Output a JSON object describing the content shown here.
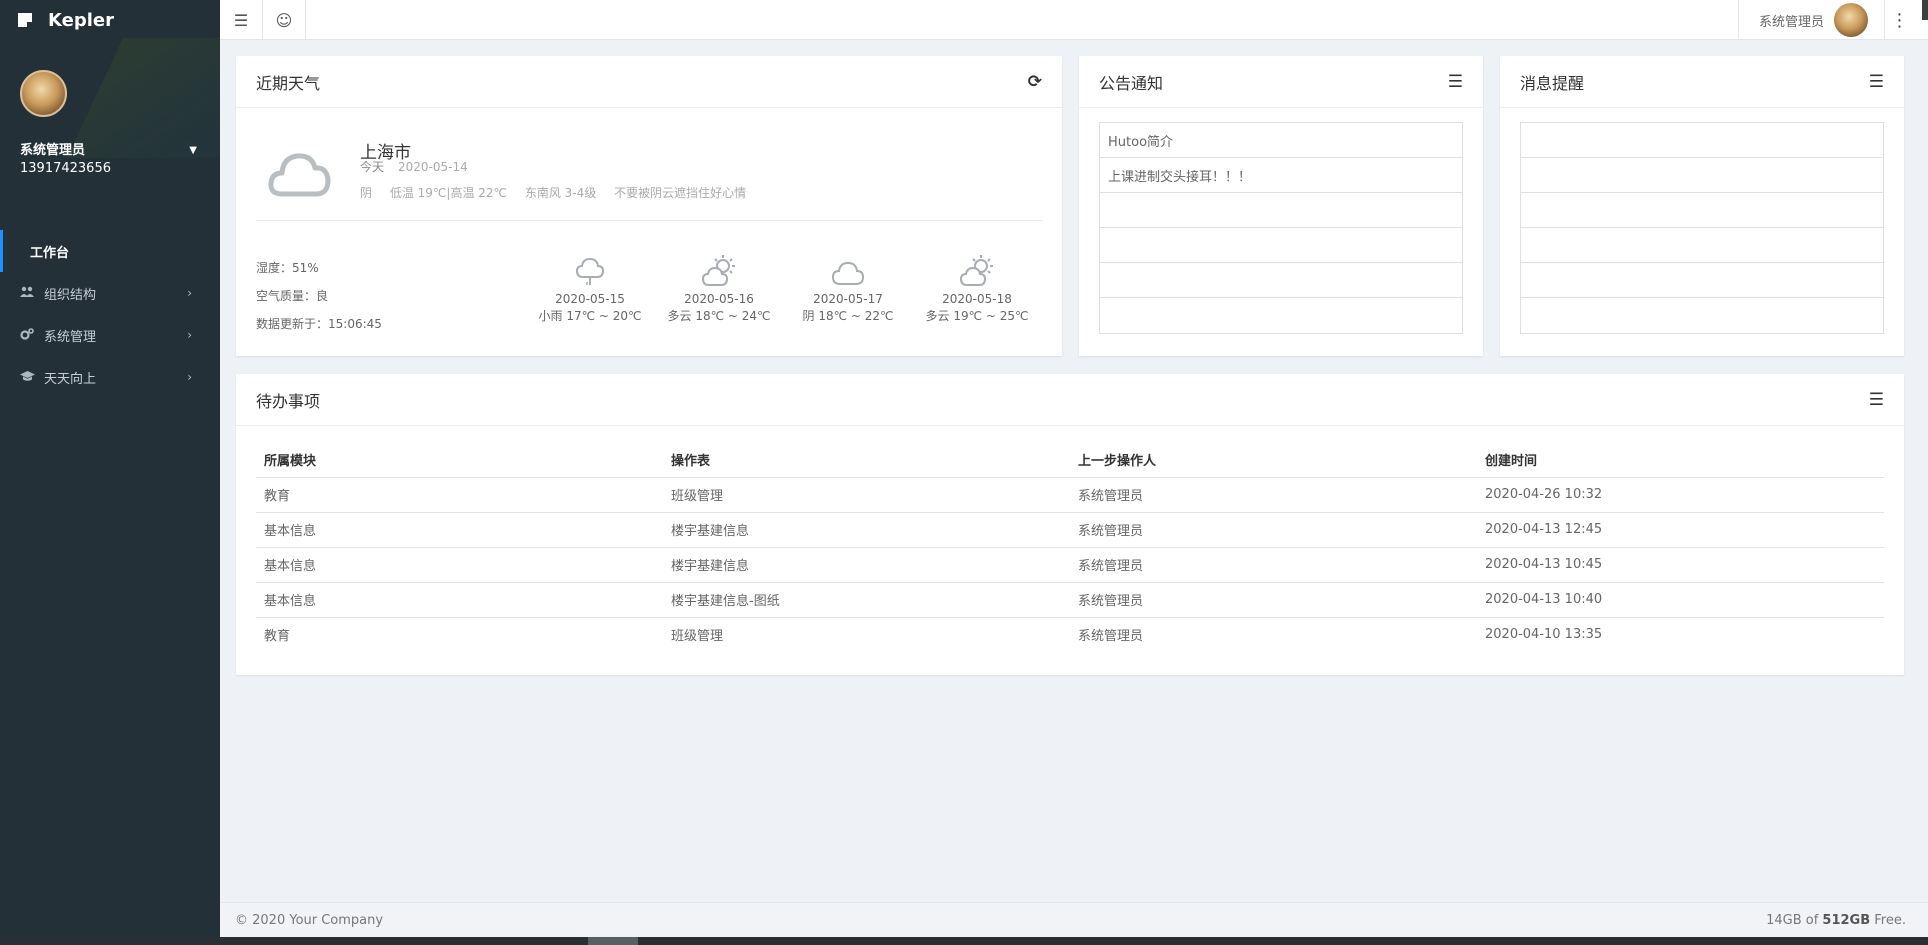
{
  "app": {
    "brand": "Kepler"
  },
  "user": {
    "name": "系统管理员",
    "phone": "13917423656"
  },
  "sidebar": {
    "items": [
      {
        "label": "工作台",
        "icon": "none",
        "active": true
      },
      {
        "label": "组织结构",
        "icon": "users-icon"
      },
      {
        "label": "系统管理",
        "icon": "cogs-icon"
      },
      {
        "label": "天天向上",
        "icon": "graduation-cap-icon"
      }
    ]
  },
  "topbar": {
    "user_label": "系统管理员"
  },
  "weather": {
    "title": "近期天气",
    "city": "上海市",
    "today_label": "今天",
    "today_date": "2020-05-14",
    "cond": "阴",
    "temp": "低温 19℃|高温 22℃",
    "wind": "东南风 3-4级",
    "tip": "不要被阴云遮挡住好心情",
    "humidity": "湿度：51%",
    "air": "空气质量：良",
    "updated": "数据更新于：15:06:45",
    "forecast": [
      {
        "date": "2020-05-15",
        "desc": "小雨 17℃ ~ 20℃",
        "icon": "rain-cloud-icon"
      },
      {
        "date": "2020-05-16",
        "desc": "多云 18℃ ~ 24℃",
        "icon": "partly-cloudy-icon"
      },
      {
        "date": "2020-05-17",
        "desc": "阴 18℃ ~ 22℃",
        "icon": "cloud-icon"
      },
      {
        "date": "2020-05-18",
        "desc": "多云 19℃ ~ 25℃",
        "icon": "partly-cloudy-icon"
      }
    ]
  },
  "notice": {
    "title": "公告通知",
    "items": [
      "Hutoo简介",
      "上课进制交头接耳！！！",
      "",
      "",
      "",
      ""
    ]
  },
  "message": {
    "title": "消息提醒",
    "items": [
      "",
      "",
      "",
      "",
      "",
      ""
    ]
  },
  "todo": {
    "title": "待办事项",
    "columns": [
      "所属模块",
      "操作表",
      "上一步操作人",
      "创建时间"
    ],
    "rows": [
      [
        "教育",
        "班级管理",
        "系统管理员",
        "2020-04-26 10:32"
      ],
      [
        "基本信息",
        "楼宇基建信息",
        "系统管理员",
        "2020-04-13 12:45"
      ],
      [
        "基本信息",
        "楼宇基建信息",
        "系统管理员",
        "2020-04-13 10:45"
      ],
      [
        "基本信息",
        "楼宇基建信息-图纸",
        "系统管理员",
        "2020-04-13 10:40"
      ],
      [
        "教育",
        "班级管理",
        "系统管理员",
        "2020-04-10 13:35"
      ]
    ]
  },
  "footer": {
    "copyright": "© 2020 Your Company",
    "storage_used": "14GB of ",
    "storage_total": "512GB",
    "storage_suffix": " Free."
  },
  "colors": {
    "sidebar_bg": "#233037",
    "active_accent": "#1e90ff",
    "page_bg": "#eef1f5"
  }
}
